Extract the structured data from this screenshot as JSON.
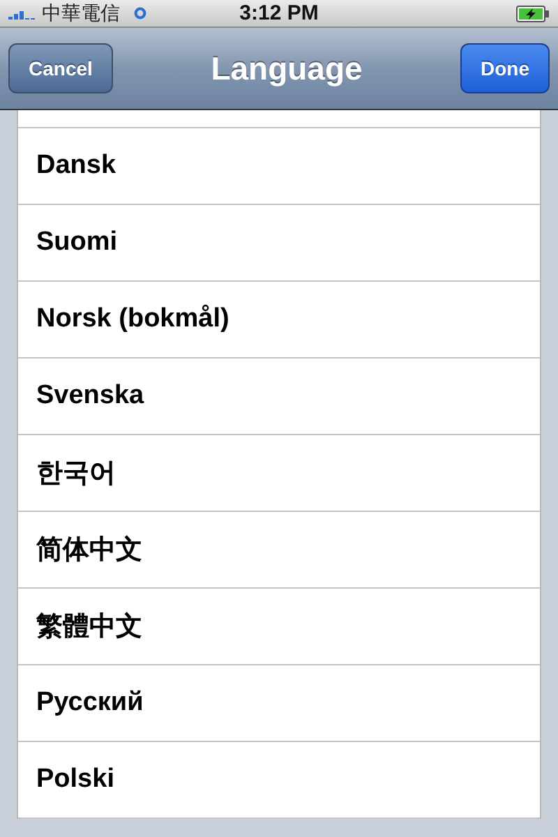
{
  "status_bar": {
    "carrier": "中華電信",
    "time": "3:12 PM"
  },
  "nav_bar": {
    "title": "Language",
    "left_button": "Cancel",
    "right_button": "Done"
  },
  "languages": [
    {
      "label": "Dansk"
    },
    {
      "label": "Suomi"
    },
    {
      "label": "Norsk (bokmål)"
    },
    {
      "label": "Svenska"
    },
    {
      "label": "한국어"
    },
    {
      "label": "简体中文"
    },
    {
      "label": "繁體中文"
    },
    {
      "label": "Русский"
    },
    {
      "label": "Polski"
    }
  ]
}
